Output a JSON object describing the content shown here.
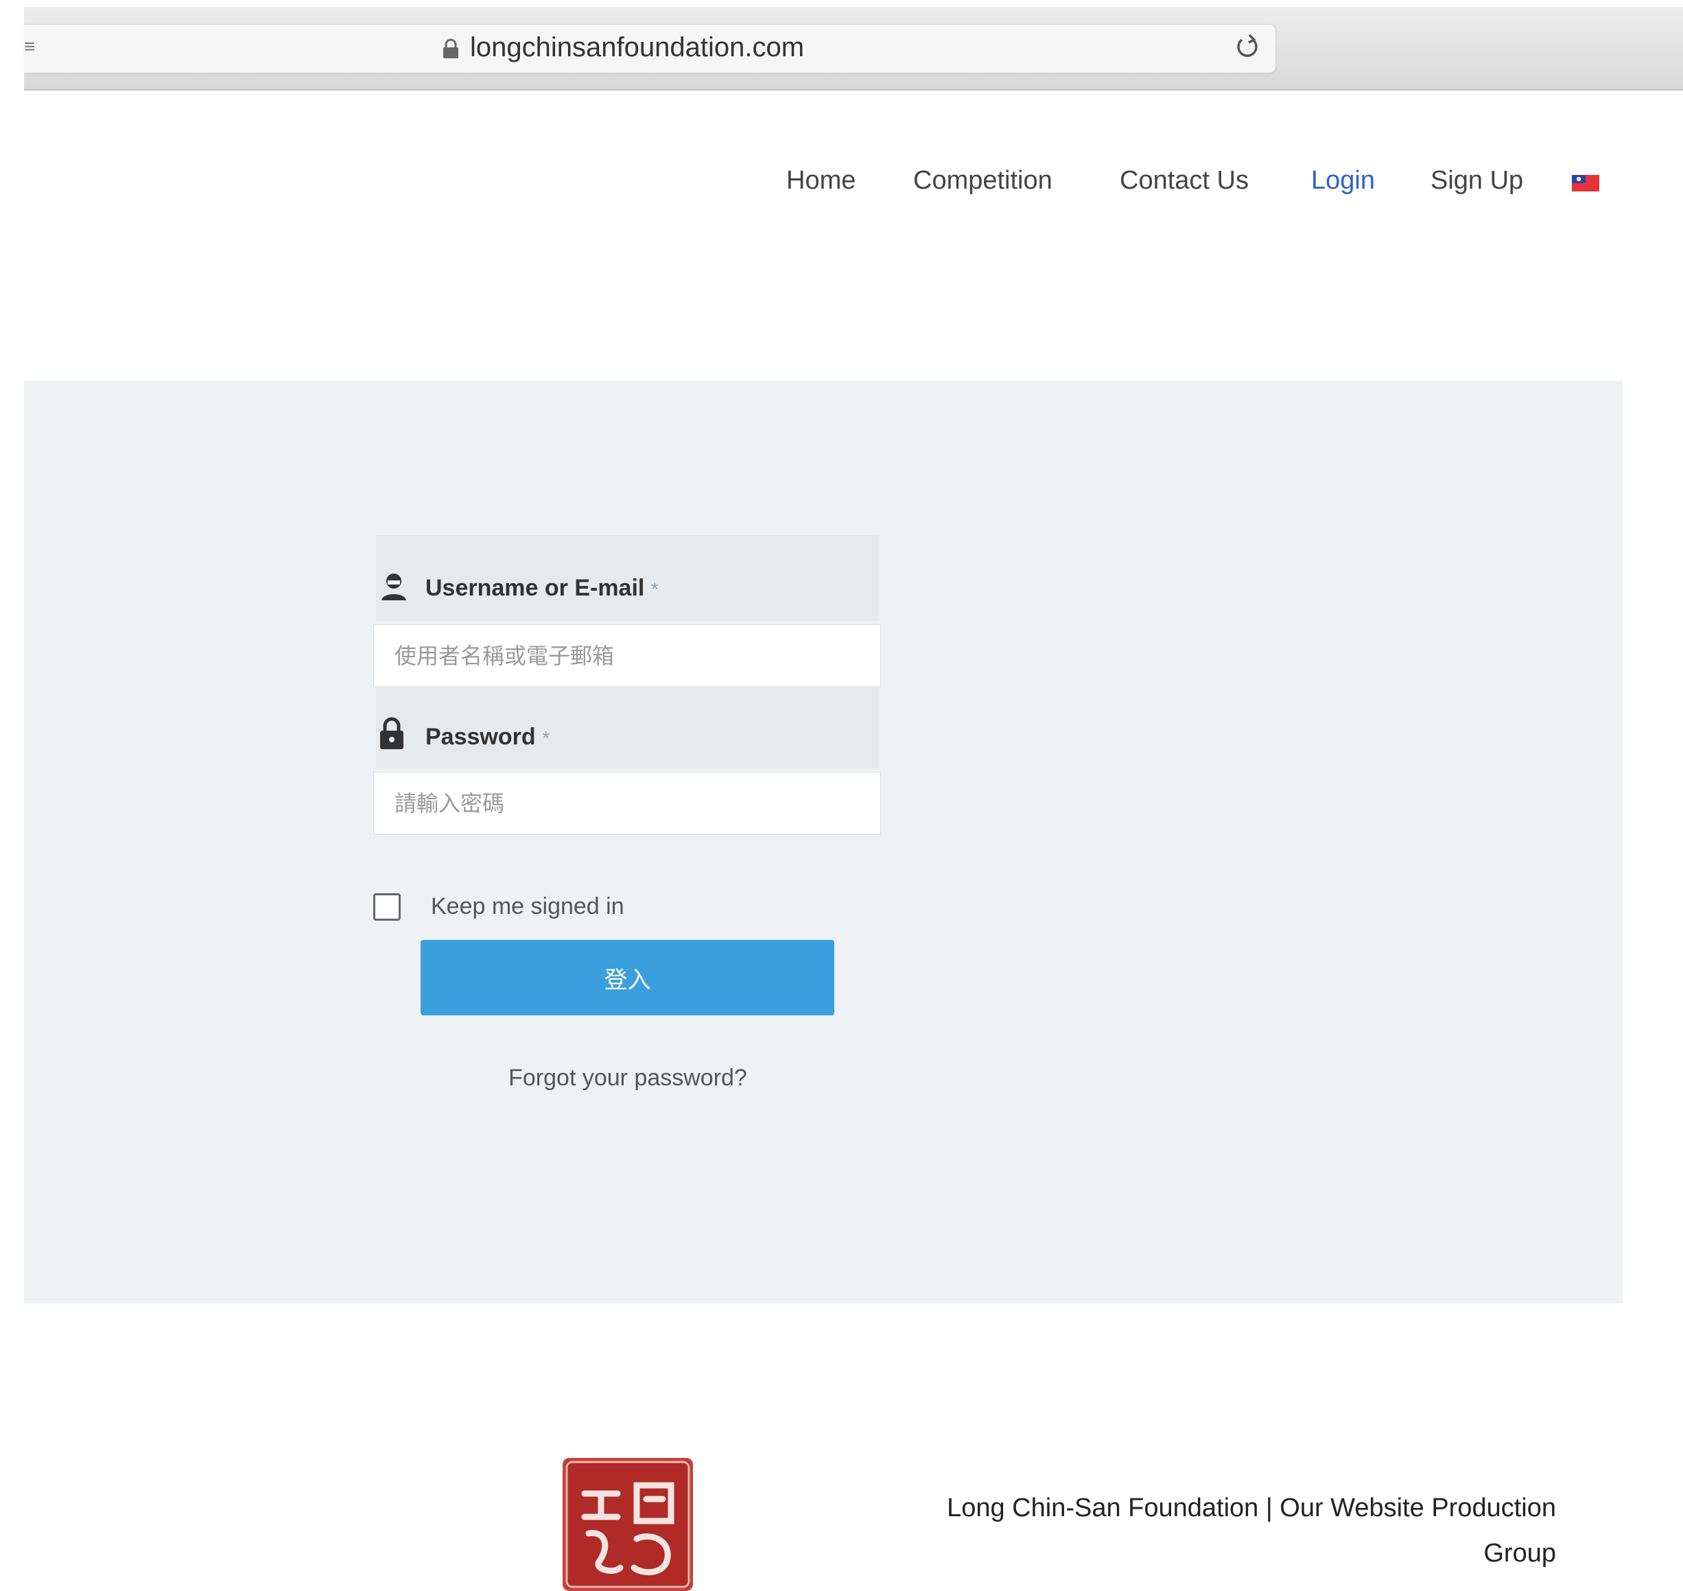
{
  "browser": {
    "url": "longchinsanfoundation.com",
    "sidebar_glyph": "≡"
  },
  "nav": {
    "items": [
      {
        "label": "Home"
      },
      {
        "label": "Competition"
      },
      {
        "label": "Contact Us"
      },
      {
        "label": "Login",
        "active": true
      },
      {
        "label": "Sign Up"
      }
    ],
    "active_color": "#2c63c9"
  },
  "login_form": {
    "username": {
      "label": "Username or E-mail",
      "required_mark": "*",
      "placeholder": "使用者名稱或電子郵箱",
      "value": ""
    },
    "password": {
      "label": "Password",
      "required_mark": "*",
      "placeholder": "請輸入密碼",
      "value": ""
    },
    "remember": {
      "label": "Keep me signed in",
      "checked": false
    },
    "submit_label": "登入",
    "submit_color": "#3a9fdc",
    "forgot_link": "Forgot your password?"
  },
  "footer": {
    "text_line1": "Long Chin-San Foundation | Our Website Production",
    "text_line2": "Group",
    "seal_color": "#b02a27"
  }
}
